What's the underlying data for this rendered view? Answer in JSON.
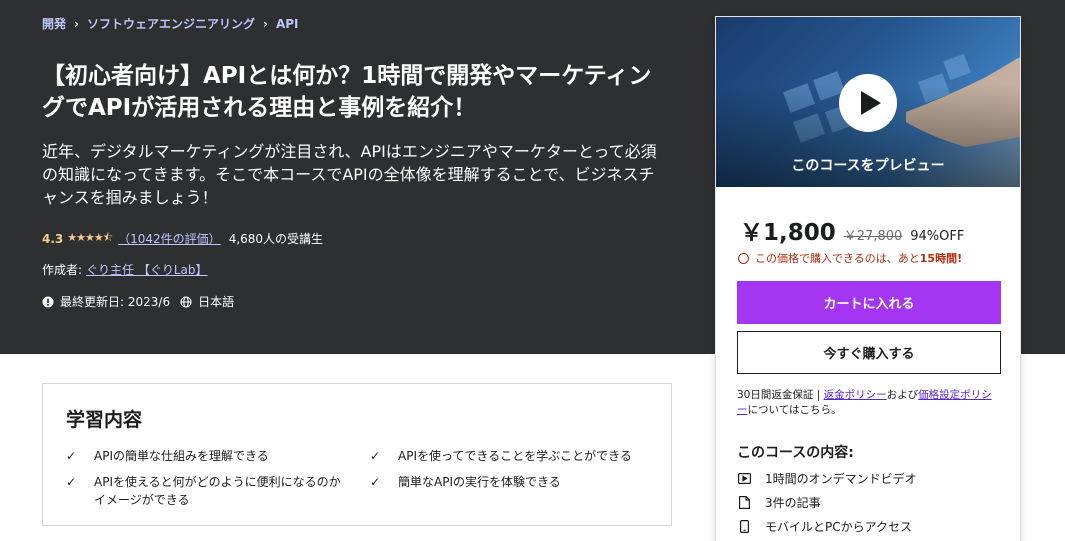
{
  "breadcrumb": [
    "開発",
    "ソフトウェアエンジニアリング",
    "API"
  ],
  "breadcrumb_sep": "›",
  "course": {
    "title": "【初心者向け】APIとは何か？1時間で開発やマーケティングでAPIが活用される理由と事例を紹介！",
    "subtitle": "近年、デジタルマーケティングが注目され、APIはエンジニアやマーケターとって必須の知識になってきます。そこで本コースでAPIの全体像を理解することで、ビジネスチャンスを掴みましょう！",
    "rating": "4.3",
    "stars": "★★★★⯪",
    "reviews": "（1042件の評価）",
    "students": "4,680人の受講生",
    "author_label": "作成者:",
    "author": "ぐり主任 【ぐりLab】",
    "updated": "最終更新日: 2023/6",
    "language": "日本語"
  },
  "card": {
    "preview_label": "このコースをプレビュー",
    "price": "￥1,800",
    "original_price": "￥27,800",
    "discount": "94%OFF",
    "timer_prefix": "この価格で購入できるのは、あと",
    "timer_bold": "15時間!",
    "cart_button": "カートに入れる",
    "buy_button": "今すぐ購入する",
    "guarantee_prefix": "30日間返金保証 | ",
    "refund_policy": "返金ポリシー",
    "and": "および",
    "pricing_policy": "価格設定ポリシー",
    "suffix": "についてはこちら。",
    "includes_title": "このコースの内容:",
    "includes": [
      {
        "icon": "video-icon",
        "label": "1時間のオンデマンドビデオ"
      },
      {
        "icon": "file-icon",
        "label": "3件の記事"
      },
      {
        "icon": "mobile-icon",
        "label": "モバイルとPCからアクセス"
      }
    ]
  },
  "learn": {
    "title": "学習内容",
    "items": [
      "APIの簡単な仕組みを理解できる",
      "APIを使ってできることを学ぶことができる",
      "APIを使えると何がどのように便利になるのかイメージができる",
      "簡単なAPIの実行を体験できる"
    ]
  },
  "colors": {
    "hero_bg": "#2d2f31",
    "accent": "#a435f0",
    "link": "#c0c4fc",
    "star": "#f3ca8c",
    "timer": "#b32d0f"
  }
}
